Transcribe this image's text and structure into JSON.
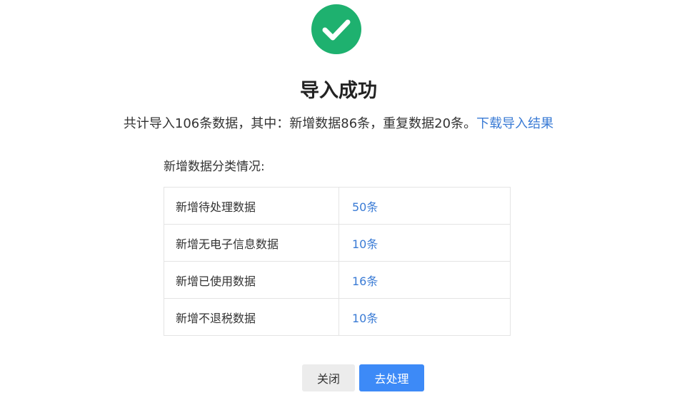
{
  "colors": {
    "success": "#1eb16f",
    "link": "#3a7bd5",
    "primary_button": "#3d8af7",
    "secondary_button": "#ececec"
  },
  "icon": "check-circle-icon",
  "title": "导入成功",
  "summary": {
    "text": "共计导入106条数据，其中：新增数据86条，重复数据20条。",
    "link_label": "下载导入结果"
  },
  "breakdown": {
    "label": "新增数据分类情况:",
    "rows": [
      {
        "category": "新增待处理数据",
        "count": "50条"
      },
      {
        "category": "新增无电子信息数据",
        "count": "10条"
      },
      {
        "category": "新增已使用数据",
        "count": "16条"
      },
      {
        "category": "新增不退税数据",
        "count": "10条"
      }
    ]
  },
  "buttons": {
    "close": "关闭",
    "process": "去处理"
  }
}
